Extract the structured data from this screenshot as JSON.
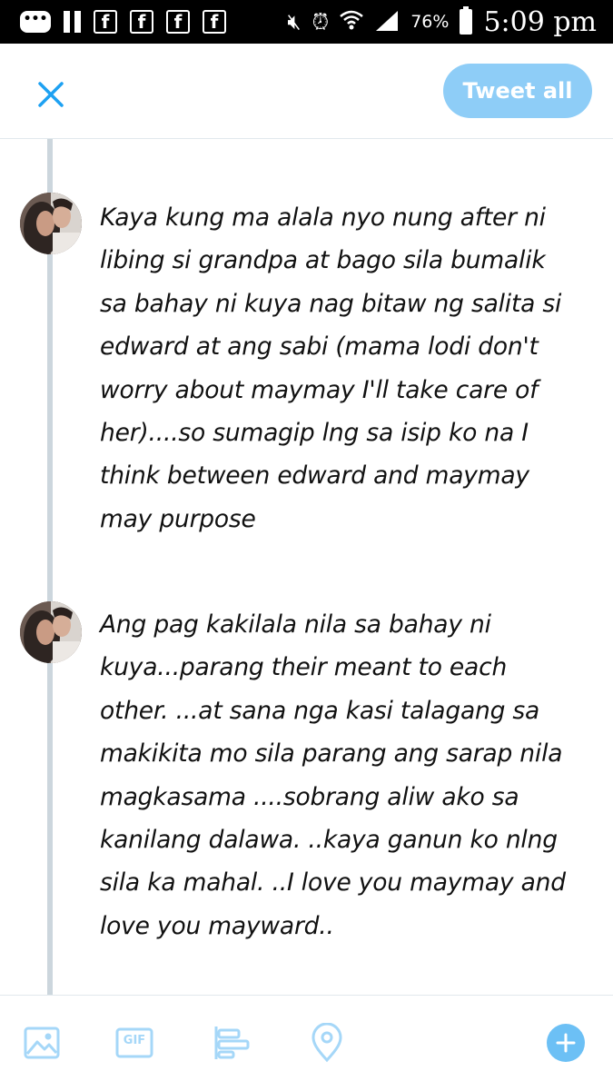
{
  "status_bar": {
    "battery_percent": "76%",
    "time": "5:09 pm",
    "notification_icons": [
      "message-icon",
      "pause-icon",
      "facebook-icon",
      "facebook-icon",
      "facebook-icon",
      "facebook-icon",
      "mute-icon",
      "alarm-icon",
      "wifi-icon",
      "signal-icon",
      "battery-icon"
    ]
  },
  "header": {
    "tweet_all_label": "Tweet all",
    "colors": {
      "accent": "#8ecdf7",
      "close": "#1da1f2"
    }
  },
  "thread": {
    "tweets": [
      {
        "text": "Kaya kung ma alala nyo nung after ni\nlibing si grandpa at bago sila bumalik\nsa bahay ni kuya nag bitaw ng salita si\nedward at ang sabi (mama lodi don't\nworry about maymay I'll take care of\nher)....so sumagip lng sa isip ko na I\nthink between edward and maymay\nmay purpose"
      },
      {
        "text": "Ang pag kakilala nila sa bahay ni\nkuya...parang their meant to each\nother. ...at sana nga kasi talagang sa\nmakikita mo sila parang ang sarap nila\nmagkasama ....sobrang aliw ako sa\nkanilang dalawa. ..kaya ganun ko nlng\nsila ka mahal. ..I love you maymay and\nlove you mayward.."
      }
    ]
  },
  "toolbar": {
    "gif_label": "GIF",
    "icons": [
      "image-icon",
      "gif-icon",
      "poll-icon",
      "location-icon",
      "add-tweet-icon"
    ]
  }
}
